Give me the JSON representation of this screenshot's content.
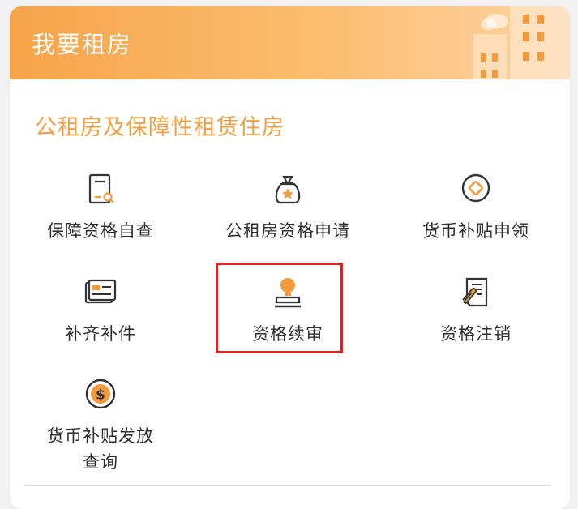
{
  "header": {
    "title": "我要租房"
  },
  "section": {
    "title": "公租房及保障性租赁住房"
  },
  "items": [
    {
      "label": "保障资格自查",
      "icon": "document-search-icon"
    },
    {
      "label": "公租房资格申请",
      "icon": "money-bag-star-icon"
    },
    {
      "label": "货币补贴申领",
      "icon": "diamond-coin-icon"
    },
    {
      "label": "补齐补件",
      "icon": "id-card-icon"
    },
    {
      "label": "资格续审",
      "icon": "stamp-icon"
    },
    {
      "label": "资格注销",
      "icon": "document-clip-icon"
    },
    {
      "label": "货币补贴发放查询",
      "label_line1": "货币补贴发放",
      "label_line2": "查询",
      "icon": "dollar-coin-icon"
    }
  ],
  "colors": {
    "header_gradient_start": "#f6a449",
    "header_gradient_end": "#fdd3a3",
    "section_title": "#f0a042",
    "icon_outline": "#333333",
    "icon_accent": "#f39a3c",
    "highlight_border": "#e1221f"
  }
}
